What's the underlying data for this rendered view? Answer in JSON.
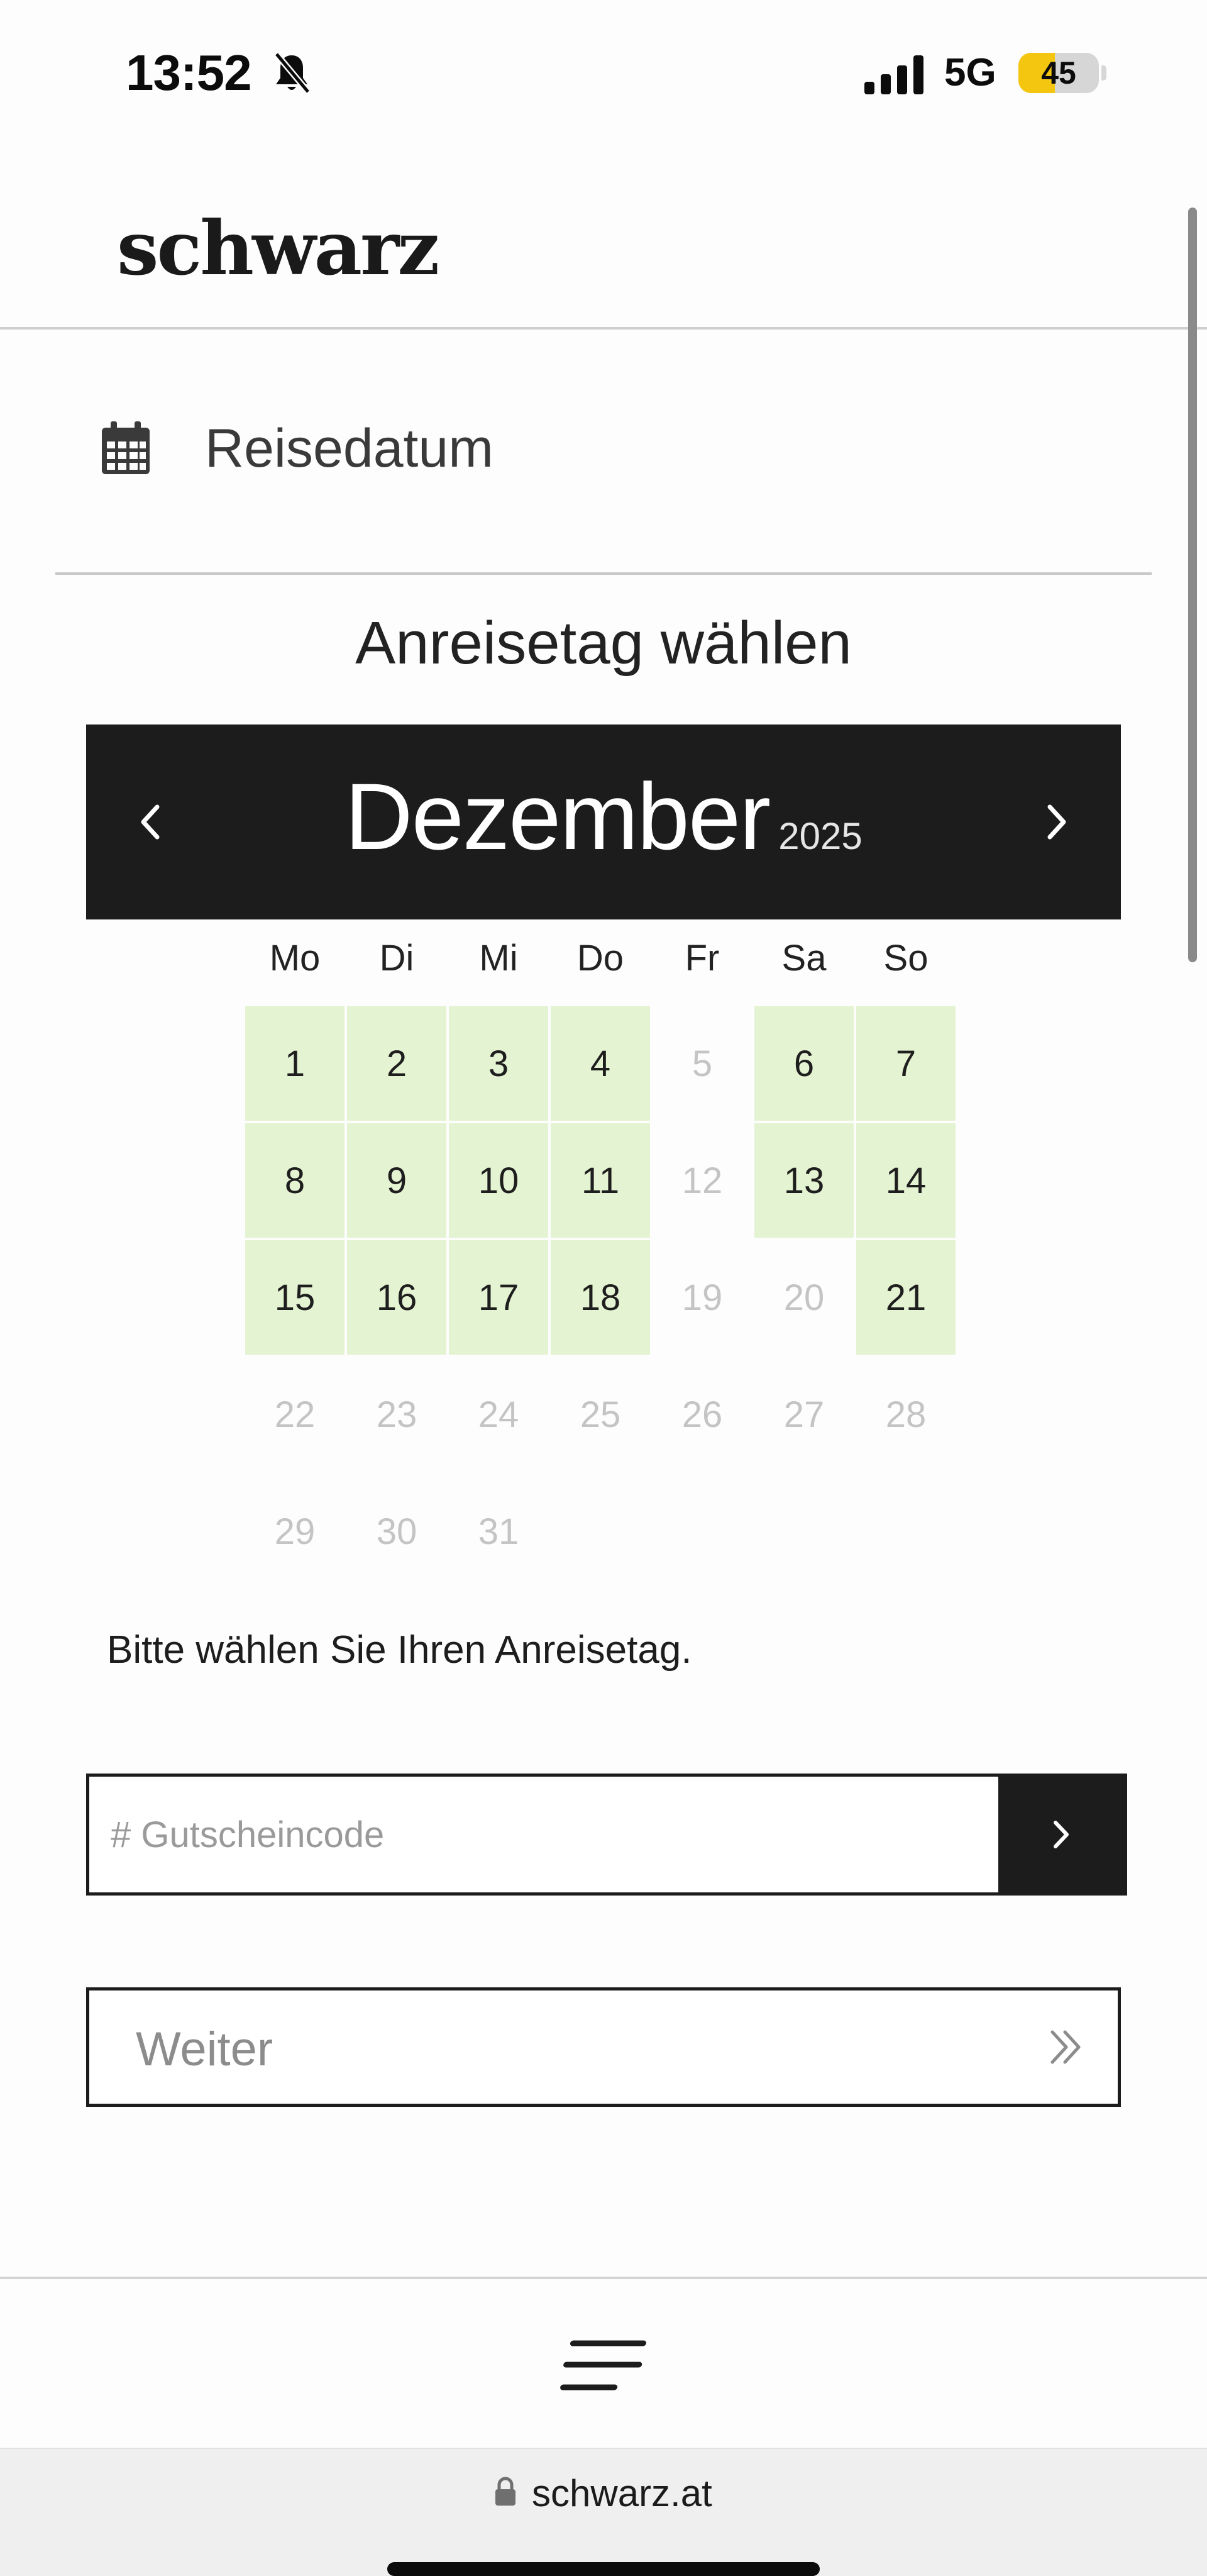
{
  "status_bar": {
    "time": "13:52",
    "network": "5G",
    "battery_percent": "45",
    "battery_level": 0.45,
    "battery_color": "#f5c60f"
  },
  "header": {
    "logo_text": "schwarz"
  },
  "section": {
    "label": "Reisedatum",
    "icon": "calendar-icon"
  },
  "calendar": {
    "heading": "Anreisetag wählen",
    "month": "Dezember",
    "year": "2025",
    "weekdays": [
      "Mo",
      "Di",
      "Mi",
      "Do",
      "Fr",
      "Sa",
      "So"
    ],
    "days": [
      {
        "n": "1",
        "available": true
      },
      {
        "n": "2",
        "available": true
      },
      {
        "n": "3",
        "available": true
      },
      {
        "n": "4",
        "available": true
      },
      {
        "n": "5",
        "available": false
      },
      {
        "n": "6",
        "available": true
      },
      {
        "n": "7",
        "available": true
      },
      {
        "n": "8",
        "available": true
      },
      {
        "n": "9",
        "available": true
      },
      {
        "n": "10",
        "available": true
      },
      {
        "n": "11",
        "available": true
      },
      {
        "n": "12",
        "available": false
      },
      {
        "n": "13",
        "available": true
      },
      {
        "n": "14",
        "available": true
      },
      {
        "n": "15",
        "available": true
      },
      {
        "n": "16",
        "available": true
      },
      {
        "n": "17",
        "available": true
      },
      {
        "n": "18",
        "available": true
      },
      {
        "n": "19",
        "available": false
      },
      {
        "n": "20",
        "available": false
      },
      {
        "n": "21",
        "available": true
      },
      {
        "n": "22",
        "available": false
      },
      {
        "n": "23",
        "available": false
      },
      {
        "n": "24",
        "available": false
      },
      {
        "n": "25",
        "available": false
      },
      {
        "n": "26",
        "available": false
      },
      {
        "n": "27",
        "available": false
      },
      {
        "n": "28",
        "available": false
      },
      {
        "n": "29",
        "available": false
      },
      {
        "n": "30",
        "available": false
      },
      {
        "n": "31",
        "available": false
      }
    ],
    "available_color": "#e4f3d1",
    "hint": "Bitte wählen Sie Ihren Anreisetag."
  },
  "voucher": {
    "placeholder": "# Gutscheincode",
    "value": ""
  },
  "continue": {
    "label": "Weiter"
  },
  "menu": {
    "icon": "menu-icon"
  },
  "browser": {
    "url": "schwarz.at"
  }
}
